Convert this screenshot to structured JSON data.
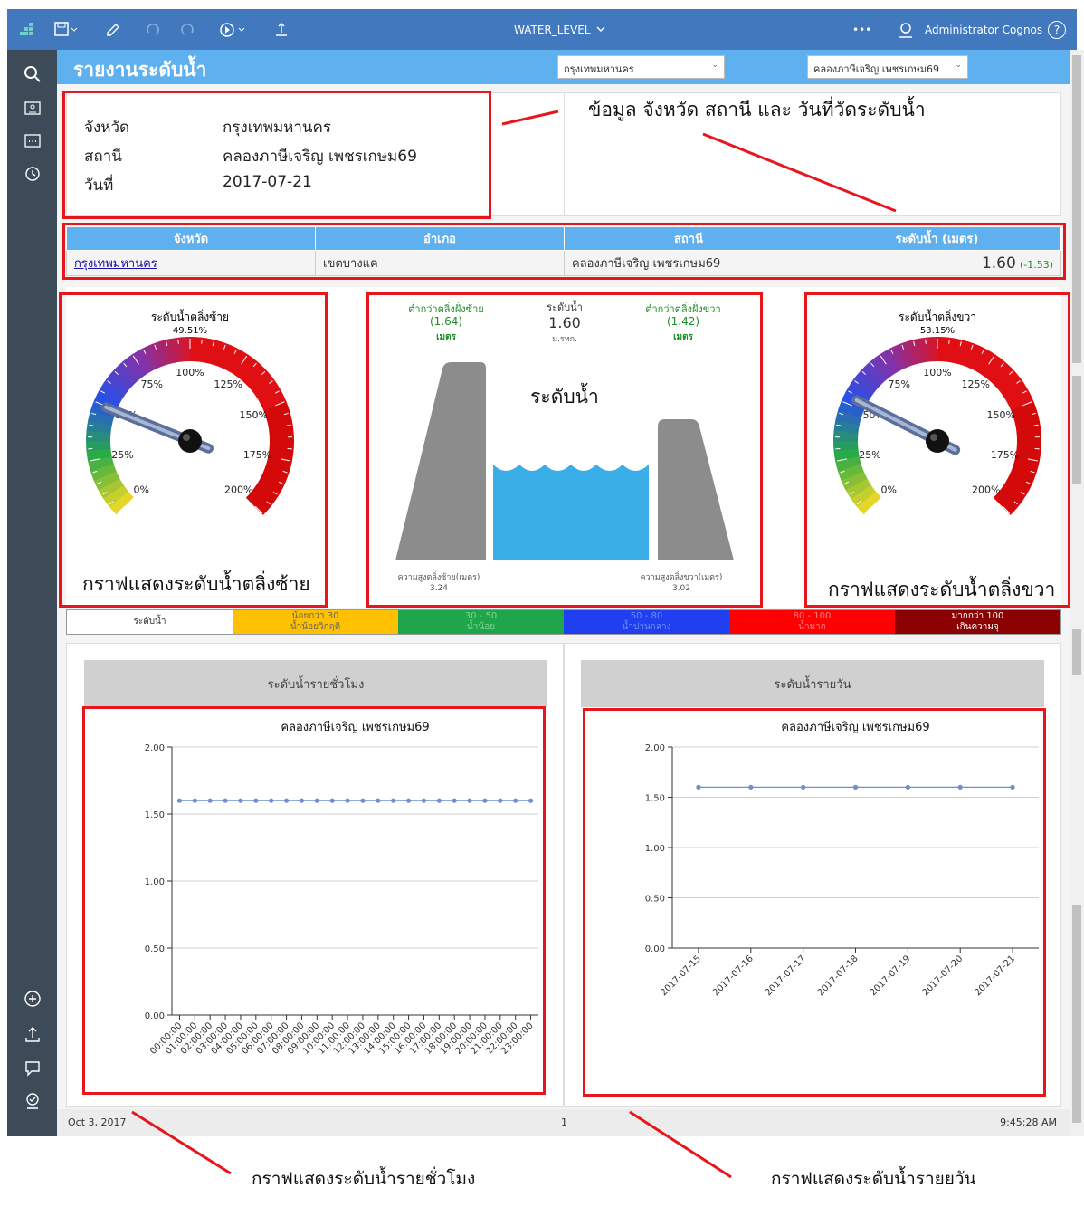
{
  "toolbar": {
    "report_name": "WATER_LEVEL",
    "more": "•••",
    "user": "Administrator Cognos",
    "help": "?"
  },
  "report": {
    "title": "รายงานระดับน้ำ",
    "province_select": "กรุงเทพมหานคร",
    "station_select": "คลองภาษีเจริญ เพชรเกษม69"
  },
  "info": {
    "province_label": "จังหวัด",
    "province_value": "กรุงเทพมหานคร",
    "station_label": "สถานี",
    "station_value": "คลองภาษีเจริญ เพชรเกษม69",
    "date_label": "วันที่",
    "date_value": "2017-07-21"
  },
  "annotations": {
    "info_note": "ข้อมูล จังหวัด สถานี และ วันที่วัดระดับน้ำ",
    "left_gauge_note": "กราฟแสดงระดับน้ำตลิ่งซ้าย",
    "right_gauge_note": "กราฟแสดงระดับน้ำตลิ่งขวา",
    "hourly_note": "กราฟแสดงระดับน้ำรายชั่วโมง",
    "daily_note": "กราฟแสดงระดับน้ำรายยวัน"
  },
  "table": {
    "headers": [
      "จังหวัด",
      "อำเภอ",
      "สถานี",
      "ระดับน้ำ (เมตร)"
    ],
    "province": "กรุงเทพมหานคร",
    "district": "เขตบางแค",
    "station": "คลองภาษีเจริญ เพชรเกษม69",
    "level": "1.60",
    "diff": "(-1.53)"
  },
  "gauge_left": {
    "title": "ระดับน้ำตลิ่งซ้าย",
    "value_text": "49.51%",
    "value": 49.51,
    "ticks": [
      "0%",
      "25%",
      "50%",
      "75%",
      "100%",
      "125%",
      "150%",
      "175%",
      "200%"
    ]
  },
  "gauge_right": {
    "title": "ระดับน้ำตลิ่งขวา",
    "value_text": "53.15%",
    "value": 53.15,
    "ticks": [
      "0%",
      "25%",
      "50%",
      "75%",
      "100%",
      "125%",
      "150%",
      "175%",
      "200%"
    ]
  },
  "dam": {
    "left_below_title": "ต่ำกว่าตลิ่งฝั่งซ้าย",
    "left_below_value": "(1.64)",
    "left_below_unit": "เมตร",
    "center_title": "ระดับน้ำ",
    "center_value": "1.60",
    "center_unit": "ม.รทก.",
    "right_below_title": "ต่ำกว่าตลิ่งฝั่งขวา",
    "right_below_value": "(1.42)",
    "right_below_unit": "เมตร",
    "water_label": "ระดับน้ำ",
    "left_bank_title": "ความสูงตลิ่งซ้าย(เมตร)",
    "left_bank_value": "3.24",
    "right_bank_title": "ความสูงตลิ่งขวา(เมตร)",
    "right_bank_value": "3.02"
  },
  "legend": [
    {
      "l1": "ระดับน้ำ",
      "l2": "",
      "bg": "#ffffff",
      "fg": "#333333"
    },
    {
      "l1": "น้อยกว่า 30",
      "l2": "น้ำน้อยวิกฤติ",
      "bg": "#ffc000",
      "fg": "#666666"
    },
    {
      "l1": "30 - 50",
      "l2": "น้ำน้อย",
      "bg": "#1fa64a",
      "fg": "#7fd29a"
    },
    {
      "l1": "50 - 80",
      "l2": "น้ำปานกลาง",
      "bg": "#1f3ff0",
      "fg": "#6f8ff8"
    },
    {
      "l1": "80 - 100",
      "l2": "น้ำมาก",
      "bg": "#ff0000",
      "fg": "#ff8080"
    },
    {
      "l1": "มากกว่า 100",
      "l2": "เกินความจุ",
      "bg": "#8b0000",
      "fg": "#ffffff"
    }
  ],
  "hourly": {
    "header": "ระดับน้ำรายชั่วโมง"
  },
  "daily": {
    "header": "ระดับน้ำรายวัน"
  },
  "chart_data": [
    {
      "type": "line",
      "title": "คลองภาษีเจริญ เพชรเกษม69",
      "x": [
        "00:00:00",
        "01:00:00",
        "02:00:00",
        "03:00:00",
        "04:00:00",
        "05:00:00",
        "06:00:00",
        "07:00:00",
        "08:00:00",
        "09:00:00",
        "10:00:00",
        "11:00:00",
        "12:00:00",
        "13:00:00",
        "14:00:00",
        "15:00:00",
        "16:00:00",
        "17:00:00",
        "18:00:00",
        "19:00:00",
        "20:00:00",
        "21:00:00",
        "22:00:00",
        "23:00:00"
      ],
      "values": [
        1.6,
        1.6,
        1.6,
        1.6,
        1.6,
        1.6,
        1.6,
        1.6,
        1.6,
        1.6,
        1.6,
        1.6,
        1.6,
        1.6,
        1.6,
        1.6,
        1.6,
        1.6,
        1.6,
        1.6,
        1.6,
        1.6,
        1.6,
        1.6
      ],
      "yticks": [
        "0.00",
        "0.50",
        "1.00",
        "1.50",
        "2.00"
      ],
      "ylim": [
        0,
        2
      ],
      "grid": true,
      "color": "#6f8fd0"
    },
    {
      "type": "line",
      "title": "คลองภาษีเจริญ เพชรเกษม69",
      "x": [
        "2017-07-15",
        "2017-07-16",
        "2017-07-17",
        "2017-07-18",
        "2017-07-19",
        "2017-07-20",
        "2017-07-21"
      ],
      "values": [
        1.6,
        1.6,
        1.6,
        1.6,
        1.6,
        1.6,
        1.6
      ],
      "yticks": [
        "0.00",
        "0.50",
        "1.00",
        "1.50",
        "2.00"
      ],
      "ylim": [
        0,
        2
      ],
      "grid": true,
      "color": "#6f8fd0"
    }
  ],
  "footer": {
    "date": "Oct 3, 2017",
    "page": "1",
    "time": "9:45:28 AM"
  }
}
